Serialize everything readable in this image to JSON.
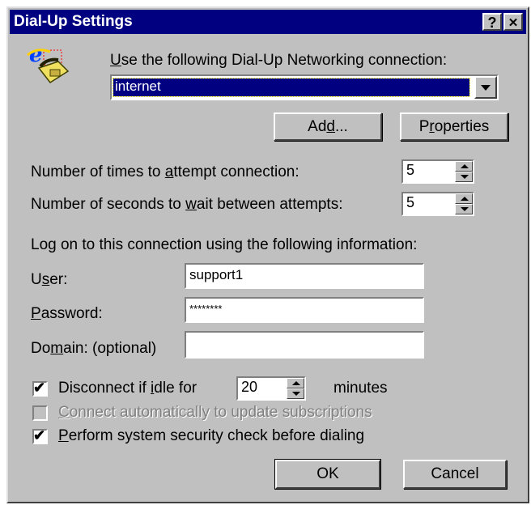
{
  "window": {
    "title": "Dial-Up Settings",
    "help_glyph": "?",
    "close_glyph": "✕"
  },
  "connection": {
    "label_pre": "",
    "label_u": "U",
    "label_post": "se the following Dial-Up Networking connection:",
    "selected": "internet",
    "add_pre": "Ad",
    "add_u": "d",
    "add_post": "...",
    "props_pre": "P",
    "props_u": "r",
    "props_post": "operties"
  },
  "attempts": {
    "label_pre": "Number of times to ",
    "label_u": "a",
    "label_post": "ttempt connection:",
    "value": "5"
  },
  "wait": {
    "label_pre": "Number of seconds to ",
    "label_u": "w",
    "label_post": "ait between attempts:",
    "value": "5"
  },
  "logon": {
    "heading": "Log on to this connection using the following information:",
    "user_pre": "U",
    "user_u": "s",
    "user_post": "er:",
    "user_value": "support1",
    "password_pre": "",
    "password_u": "P",
    "password_post": "assword:",
    "password_value": "********",
    "domain_pre": "Do",
    "domain_u": "m",
    "domain_post": "ain: (optional)",
    "domain_value": ""
  },
  "idle": {
    "checked": true,
    "label_pre": "Disconnect if ",
    "label_u": "i",
    "label_post": "dle for",
    "value": "20",
    "unit": "minutes"
  },
  "auto_connect": {
    "checked": false,
    "enabled": false,
    "label_pre": "",
    "label_u": "C",
    "label_post": "onnect automatically to update subscriptions"
  },
  "security": {
    "checked": true,
    "label_pre": "",
    "label_u": "P",
    "label_post": "erform system security check before dialing"
  },
  "buttons": {
    "ok": "OK",
    "cancel": "Cancel"
  },
  "check_glyph": "✔"
}
